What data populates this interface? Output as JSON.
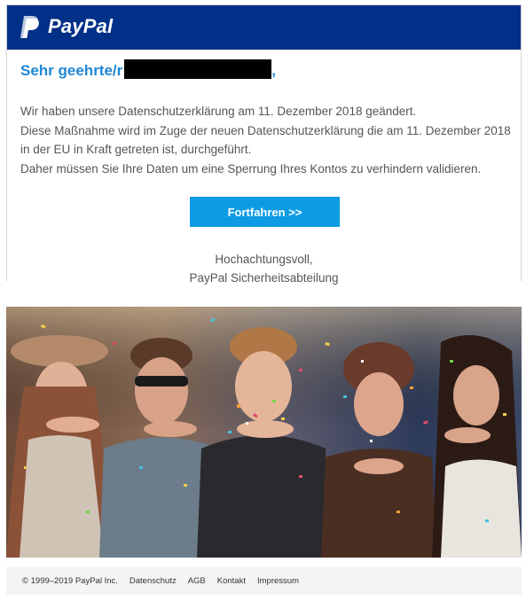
{
  "header": {
    "logo_text": "PayPal",
    "brand_color": "#013088"
  },
  "greeting": {
    "prefix": "Sehr geehrte/r",
    "suffix": ","
  },
  "body": {
    "line1": "Wir haben unsere Datenschutzerklärung am 11. Dezember 2018 geändert.",
    "line2": "Diese Maßnahme wird im Zuge der neuen Datenschutzerklärung die am 11. Dezember 2018 in der EU in Kraft getreten ist, durchgeführt.",
    "line3": "Daher müssen Sie Ihre Daten um eine Sperrung Ihres Kontos zu verhindern validieren."
  },
  "cta": {
    "label": "Fortfahren >>",
    "color": "#0d9be3"
  },
  "signoff": {
    "line1": "Hochachtungsvoll,",
    "line2": "PayPal Sicherheitsabteilung"
  },
  "photo": {
    "subject": "friends-blowing-confetti"
  },
  "footer": {
    "copyright": "© 1999–2019 PayPal Inc.",
    "links": [
      "Datenschutz",
      "AGB",
      "Kontakt",
      "Impressum"
    ]
  }
}
